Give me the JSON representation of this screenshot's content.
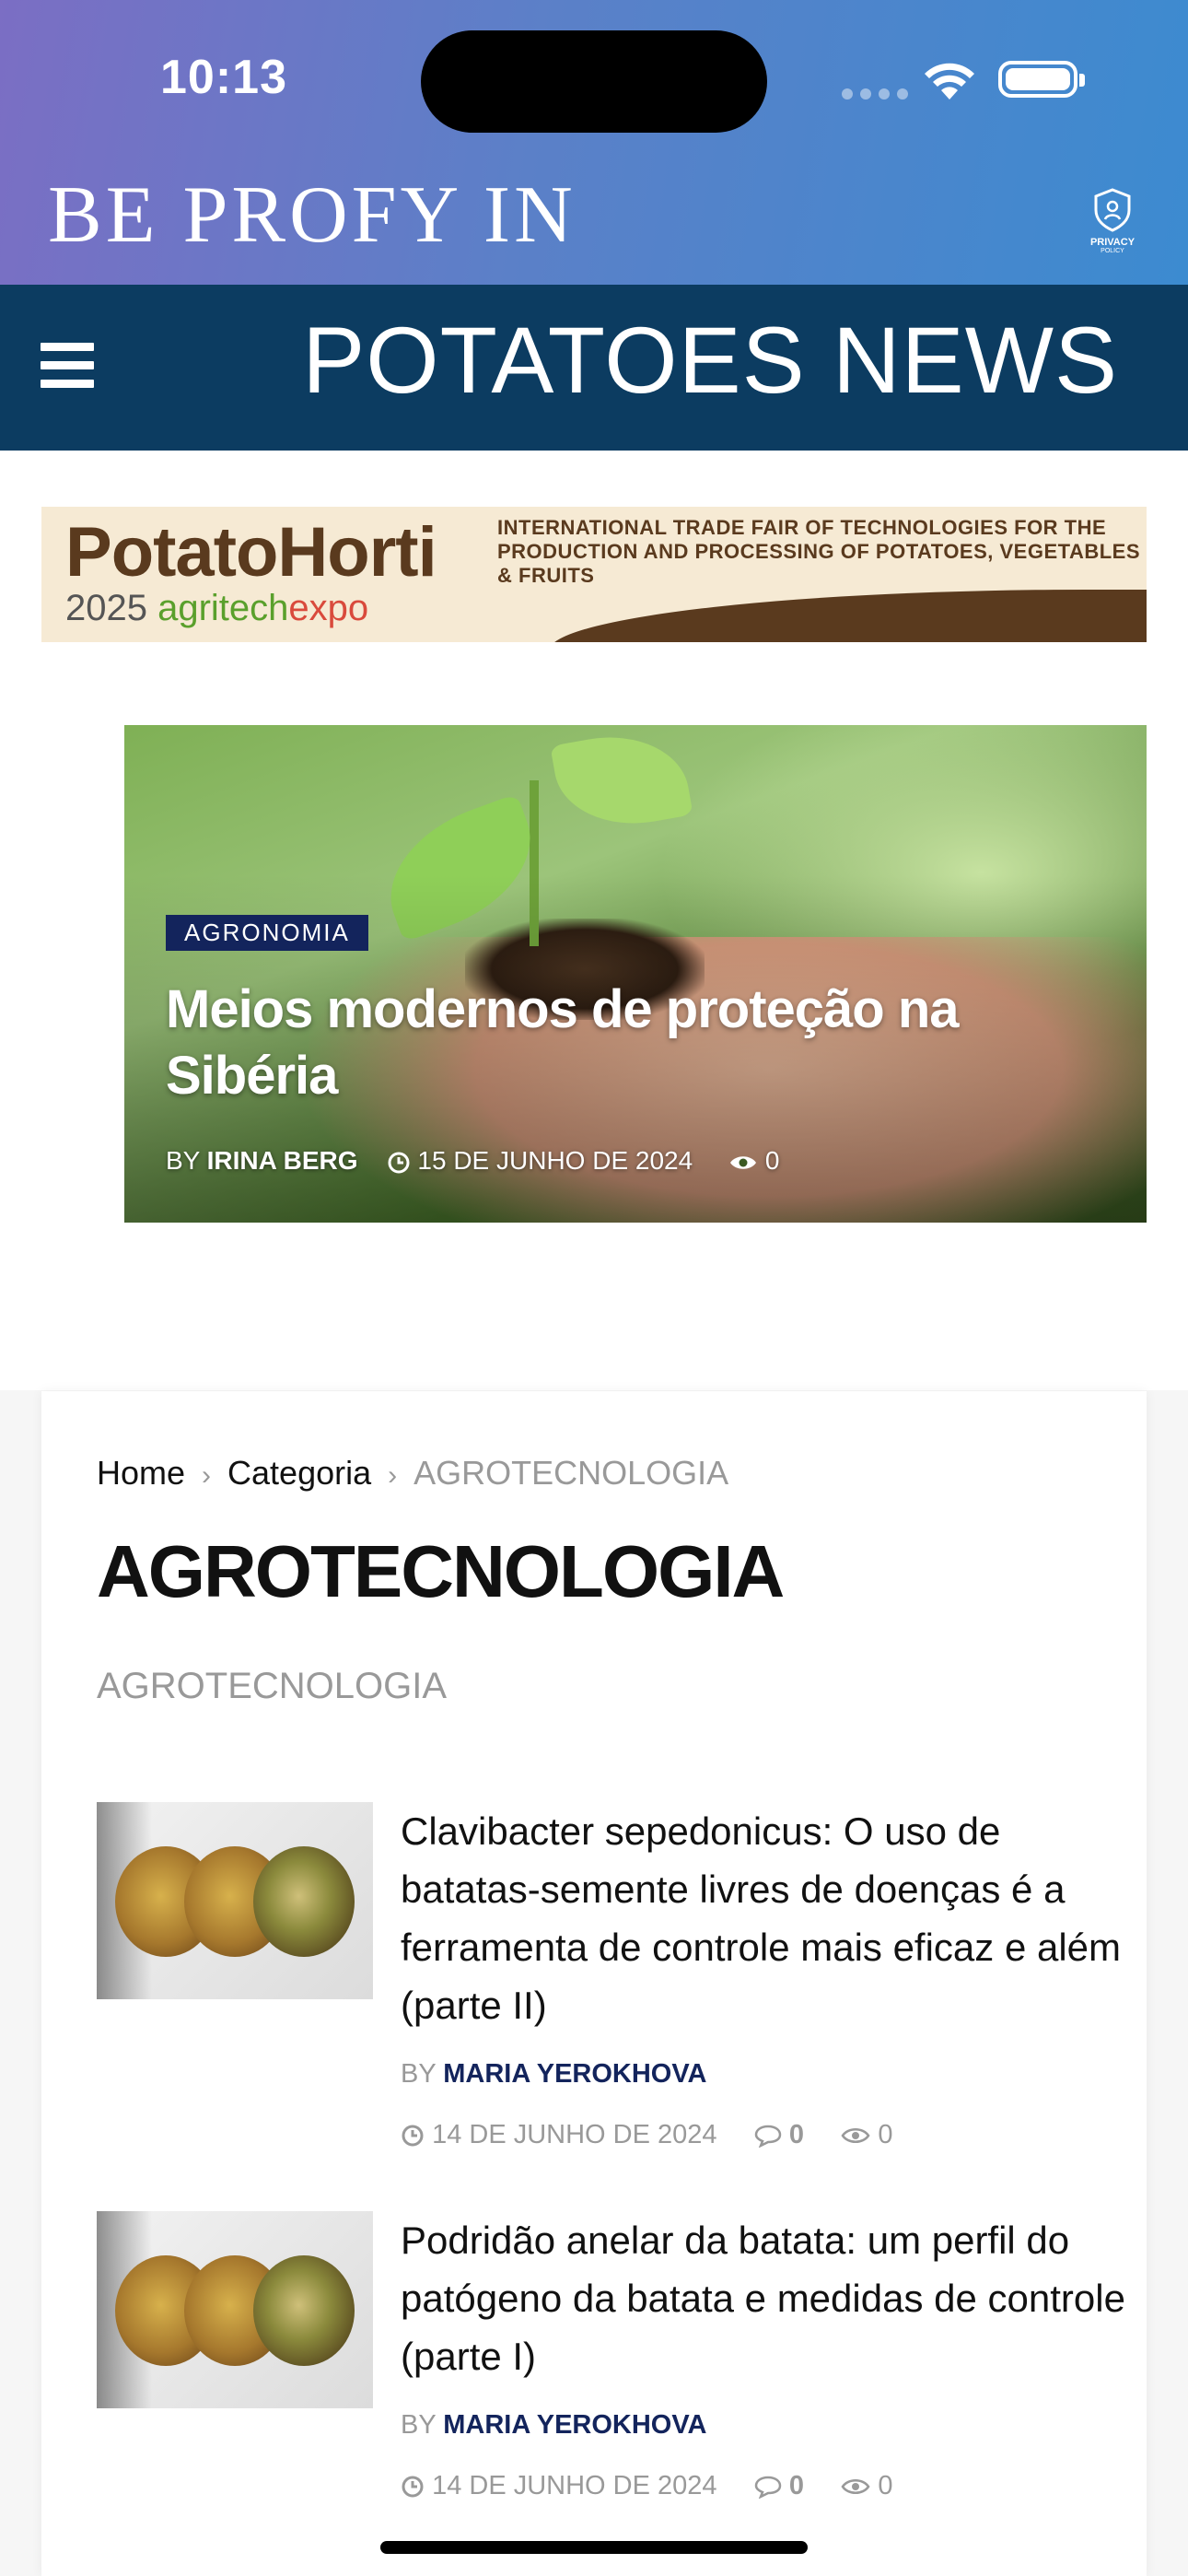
{
  "status_bar": {
    "time": "10:13"
  },
  "header": {
    "brand": "BE PROFY IN",
    "privacy_label": "PRIVACY",
    "privacy_sublabel": "POLICY",
    "site_title": "POTATOES NEWS"
  },
  "banner": {
    "brand": "PotatoHorti",
    "year": "2025",
    "agri": "agritech",
    "expo": "expo",
    "description": "INTERNATIONAL TRADE FAIR OF TECHNOLOGIES FOR THE PRODUCTION AND PROCESSING OF POTATOES, VEGETABLES & FRUITS"
  },
  "featured": {
    "category": "AGRONOMIA",
    "title": "Meios modernos de proteção na Sibéria",
    "by_label": "BY",
    "author": "IRINA BERG",
    "date": "15 DE JUNHO DE 2024",
    "views": "0"
  },
  "breadcrumb": {
    "home": "Home",
    "category": "Categoria",
    "current": "AGROTECNOLOGIA"
  },
  "page": {
    "title": "AGROTECNOLOGIA",
    "subtitle": "AGROTECNOLOGIA"
  },
  "articles": [
    {
      "title": "Clavibacter sepedonicus: O uso de batatas-semente livres de doenças é a ferramenta de controle mais eficaz e além (parte II)",
      "by_label": "BY",
      "author": "MARIA YEROKHOVA",
      "date": "14 DE JUNHO DE 2024",
      "comments": "0",
      "views": "0"
    },
    {
      "title": "Podridão anelar da batata: um perfil do patógeno da batata e medidas de controle (parte I)",
      "by_label": "BY",
      "author": "MARIA YEROKHOVA",
      "date": "14 DE JUNHO DE 2024",
      "comments": "0",
      "views": "0"
    }
  ],
  "colors": {
    "navbar": "#0c3c61",
    "badge": "#13245c",
    "author": "#13245c"
  }
}
